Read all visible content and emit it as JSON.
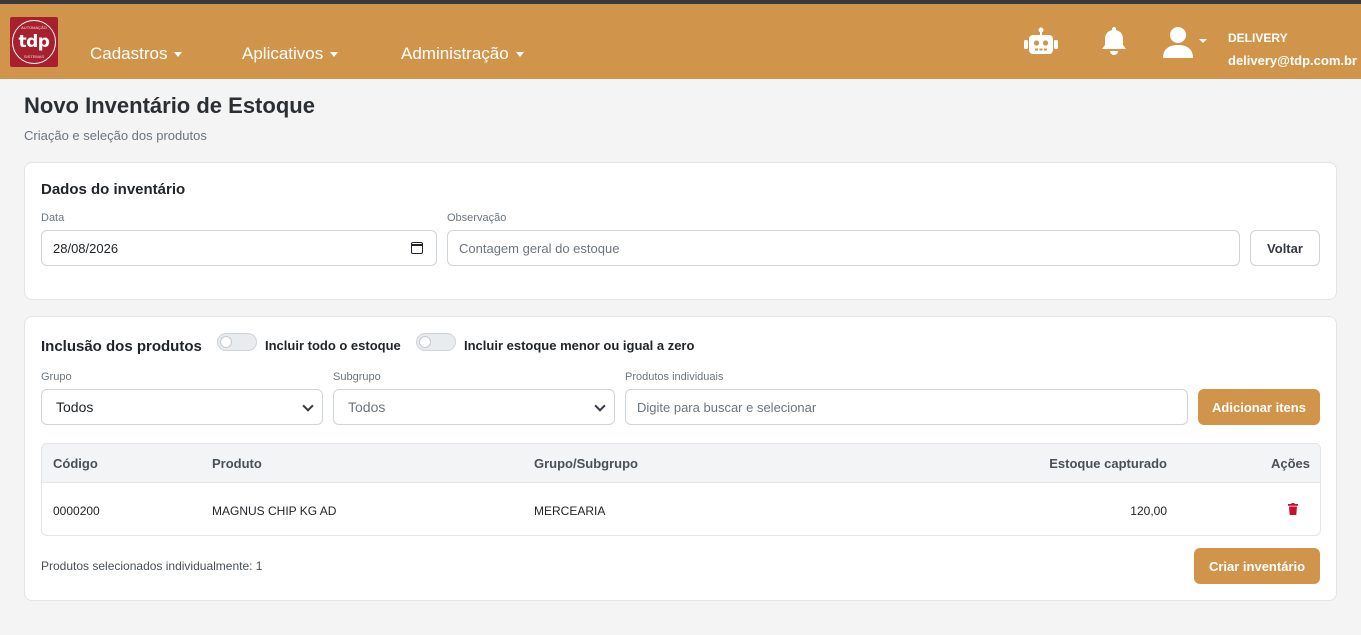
{
  "app": {
    "logo_text": "tdp",
    "logo_top_small": "AUTOMAÇÃO",
    "logo_bottom_small": "SISTEMAS"
  },
  "nav": {
    "items": [
      {
        "label": "Cadastros"
      },
      {
        "label": "Aplicativos"
      },
      {
        "label": "Administração"
      }
    ],
    "icons": [
      "robot-icon",
      "bell-icon",
      "user-icon"
    ]
  },
  "user": {
    "name": "DELIVERY",
    "email": "delivery@tdp.com.br"
  },
  "page": {
    "title": "Novo Inventário de Estoque",
    "subtitle": "Criação e seleção dos produtos"
  },
  "dados": {
    "title": "Dados do inventário",
    "data_label": "Data",
    "data_value": "28/08/2026",
    "obs_label": "Observação",
    "obs_placeholder": "Contagem geral do estoque",
    "voltar_label": "Voltar"
  },
  "inclusao": {
    "title": "Inclusão dos produtos",
    "toggle1_label": "Incluir todo o estoque",
    "toggle2_label": "Incluir estoque menor ou igual a zero",
    "grupo_label": "Grupo",
    "grupo_value": "Todos",
    "subgrupo_label": "Subgrupo",
    "subgrupo_value": "Todos",
    "produtos_label": "Produtos individuais",
    "produtos_placeholder": "Digite para buscar e selecionar",
    "adicionar_label": "Adicionar itens",
    "table": {
      "headers": [
        "Código",
        "Produto",
        "Grupo/Subgrupo",
        "Estoque capturado",
        "Ações"
      ],
      "rows": [
        {
          "codigo": "0000200",
          "produto": "MAGNUS CHIP KG AD",
          "grupo": "MERCEARIA",
          "estoque": "120,00"
        }
      ]
    },
    "footer_text": "Produtos selecionados individualmente: 1",
    "criar_label": "Criar inventário"
  },
  "colors": {
    "brand": "#d0954a",
    "logo_bg": "#a8202e",
    "danger": "#c8102e"
  }
}
